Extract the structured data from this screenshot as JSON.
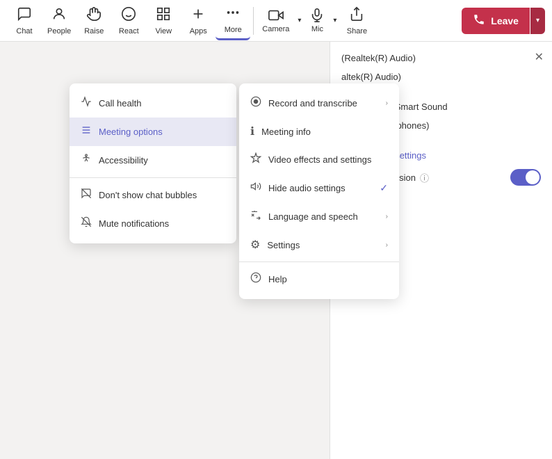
{
  "toolbar": {
    "items": [
      {
        "id": "chat",
        "label": "Chat",
        "icon": "💬"
      },
      {
        "id": "people",
        "label": "People",
        "icon": "👤"
      },
      {
        "id": "raise",
        "label": "Raise",
        "icon": "✋"
      },
      {
        "id": "react",
        "label": "React",
        "icon": "😊"
      },
      {
        "id": "view",
        "label": "View",
        "icon": "⊞"
      },
      {
        "id": "apps",
        "label": "Apps",
        "icon": "➕"
      }
    ],
    "more_label": "More",
    "camera_label": "Camera",
    "mic_label": "Mic",
    "share_label": "Share",
    "leave_label": "Leave"
  },
  "more_dropdown": {
    "items": [
      {
        "id": "record",
        "label": "Record and transcribe",
        "icon": "⏺",
        "has_arrow": true,
        "check": false
      },
      {
        "id": "meeting-info",
        "label": "Meeting info",
        "icon": "ℹ",
        "has_arrow": false,
        "check": false
      },
      {
        "id": "video-effects",
        "label": "Video effects and settings",
        "icon": "✦",
        "has_arrow": false,
        "check": false
      },
      {
        "id": "hide-audio",
        "label": "Hide audio settings",
        "icon": "🔊",
        "has_arrow": false,
        "check": true
      },
      {
        "id": "language",
        "label": "Language and speech",
        "icon": "A",
        "has_arrow": true,
        "check": false
      },
      {
        "id": "settings",
        "label": "Settings",
        "icon": "⚙",
        "has_arrow": true,
        "check": false
      },
      {
        "id": "help",
        "label": "Help",
        "icon": "?",
        "has_arrow": false,
        "check": false
      }
    ]
  },
  "left_menu": {
    "items": [
      {
        "id": "call-health",
        "label": "Call health",
        "icon": "📊",
        "selected": false
      },
      {
        "id": "meeting-options",
        "label": "Meeting options",
        "icon": "≡",
        "selected": true
      },
      {
        "id": "accessibility",
        "label": "Accessibility",
        "icon": "♿",
        "selected": false
      },
      {
        "id": "dont-show-bubbles",
        "label": "Don't show chat bubbles",
        "icon": "💭",
        "selected": false,
        "divider_before": true
      },
      {
        "id": "mute-notifications",
        "label": "Mute notifications",
        "icon": "🔔",
        "selected": false
      }
    ]
  },
  "right_panel": {
    "audio_device_1": "(Realtek(R) Audio)",
    "audio_device_2": "altek(R) Audio)",
    "audio_device_3": "Array (Intel® Smart Sound",
    "audio_device_4": "r Digital Microphones)",
    "advanced_settings_label": "▼ Advanced settings",
    "noise_suppression_label": "Noise suppression",
    "info_icon": "ⓘ"
  }
}
